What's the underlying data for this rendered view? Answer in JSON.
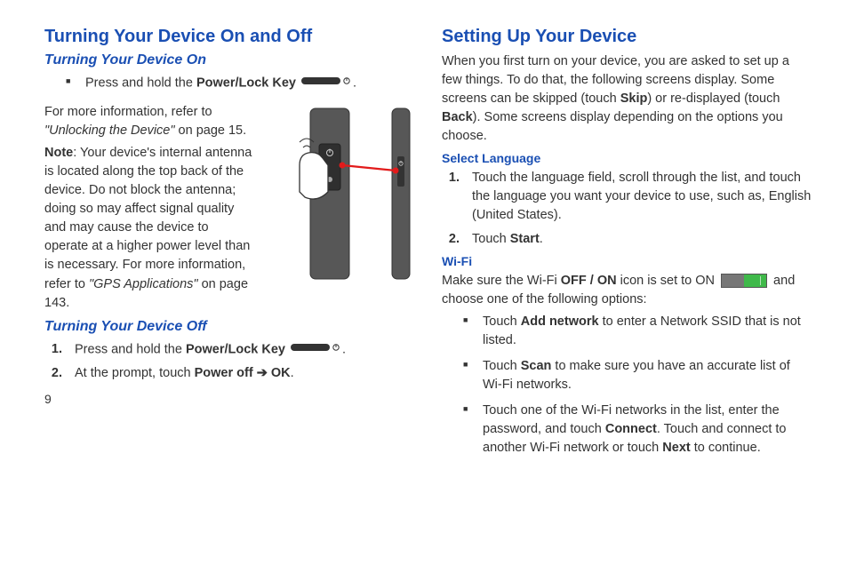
{
  "pageNumber": "9",
  "left": {
    "h1": "Turning Your Device On and Off",
    "h2_on": "Turning Your Device On",
    "bullet_on": "Press and hold the ",
    "bullet_on_bold": "Power/Lock Key",
    "info_1": "For more information, refer to ",
    "info_1_ref": "\"Unlocking the Device\"",
    "info_1_tail": " on page 15.",
    "note_label": "Note",
    "note_body": ": Your device's internal antenna is located along the top back of the device. Do not block the antenna; doing so may affect signal quality and may cause the device to operate at a higher power level than is necessary. For more information, refer to ",
    "note_ref": "\"GPS Applications\"",
    "note_tail": " on page 143.",
    "h2_off": "Turning Your Device Off",
    "off_step1_a": "Press and hold the ",
    "off_step1_b": "Power/Lock Key",
    "off_step2_a": "At the prompt, touch ",
    "off_step2_b": "Power off",
    "off_step2_arrow": " ➔ ",
    "off_step2_c": "OK",
    "off_step2_tail": "."
  },
  "right": {
    "h1": "Setting Up Your Device",
    "intro_a": "When you first turn on your device, you are asked to set up a few things. To do that, the following screens display. Some screens can be skipped (touch ",
    "intro_skip": "Skip",
    "intro_b": ") or re-displayed (touch ",
    "intro_back": "Back",
    "intro_c": "). Some screens display depending on the options you choose.",
    "h3_lang": "Select Language",
    "lang_step1": "Touch the language field, scroll through the list, and touch the language you want your device to use, such as, English (United States).",
    "lang_step2_a": "Touch ",
    "lang_step2_b": "Start",
    "lang_step2_tail": ".",
    "h3_wifi": "Wi-Fi",
    "wifi_intro_a": "Make sure the Wi-Fi ",
    "wifi_intro_bold": "OFF / ON",
    "wifi_intro_b": " icon is set to ON ",
    "wifi_intro_c": " and choose one of the following options:",
    "wifi_b1_a": "Touch ",
    "wifi_b1_bold": "Add network",
    "wifi_b1_b": " to enter a Network SSID that is not listed.",
    "wifi_b2_a": "Touch ",
    "wifi_b2_bold": "Scan",
    "wifi_b2_b": " to make sure you have an accurate list of Wi-Fi networks.",
    "wifi_b3_a": "Touch one of the Wi-Fi networks in the list, enter the password, and touch ",
    "wifi_b3_bold1": "Connect",
    "wifi_b3_b": ". Touch and connect to another Wi-Fi network or touch ",
    "wifi_b3_bold2": "Next",
    "wifi_b3_c": " to continue."
  }
}
